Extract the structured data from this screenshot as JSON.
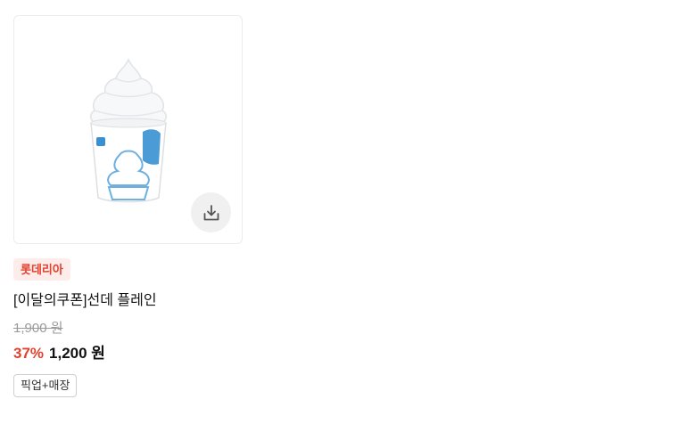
{
  "product": {
    "brand": "롯데리아",
    "title": "[이달의쿠폰]선데 플레인",
    "original_price": "1,900 원",
    "discount": "37%",
    "sale_price": "1,200 원",
    "tag": "픽업+매장",
    "image": "soft-serve-sundae-cup",
    "download_icon": "download-icon"
  },
  "colors": {
    "accent": "#e0422f",
    "badge_bg": "#fdecea"
  }
}
